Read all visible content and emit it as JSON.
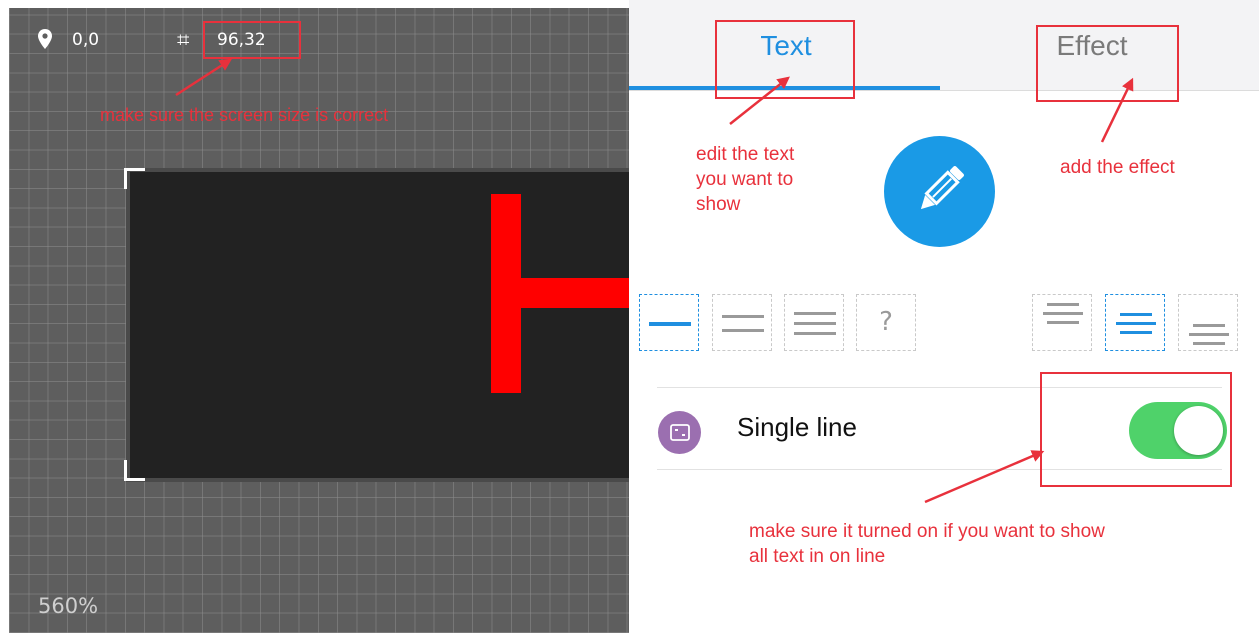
{
  "canvas": {
    "position_icon": "map-pin-icon",
    "position_value": "0,0",
    "size_icon": "grid-hash-icon",
    "size_value": "96,32",
    "zoom": "560%"
  },
  "tabs": [
    {
      "label": "Text",
      "active": true
    },
    {
      "label": "Effect",
      "active": false
    }
  ],
  "edit_button_icon": "pencil-icon",
  "line_mode_buttons": [
    {
      "name": "one-line-mode-icon",
      "selected": true
    },
    {
      "name": "two-line-mode-icon",
      "selected": false
    },
    {
      "name": "three-line-mode-icon",
      "selected": false
    },
    {
      "name": "help-icon",
      "glyph": "?",
      "selected": false
    }
  ],
  "vertical_align_buttons": [
    {
      "name": "align-top-icon",
      "selected": false
    },
    {
      "name": "align-middle-icon",
      "selected": true
    },
    {
      "name": "align-bottom-icon",
      "selected": false
    }
  ],
  "single_line": {
    "label": "Single line",
    "icon": "single-line-icon",
    "enabled": true
  },
  "annotations": {
    "screen_size": "make sure the screen size is correct",
    "edit_text": [
      "edit the text",
      "you want to",
      "show"
    ],
    "add_effect": "add the effect",
    "single_line": [
      "make sure it turned on if you want to show",
      "all text in on line"
    ]
  },
  "colors": {
    "accent": "#1f8fe0",
    "annotation": "#e8313c",
    "toggle_on": "#4fd26a",
    "led_text": "#ff0000",
    "single_line_icon": "#9b6fb0"
  }
}
